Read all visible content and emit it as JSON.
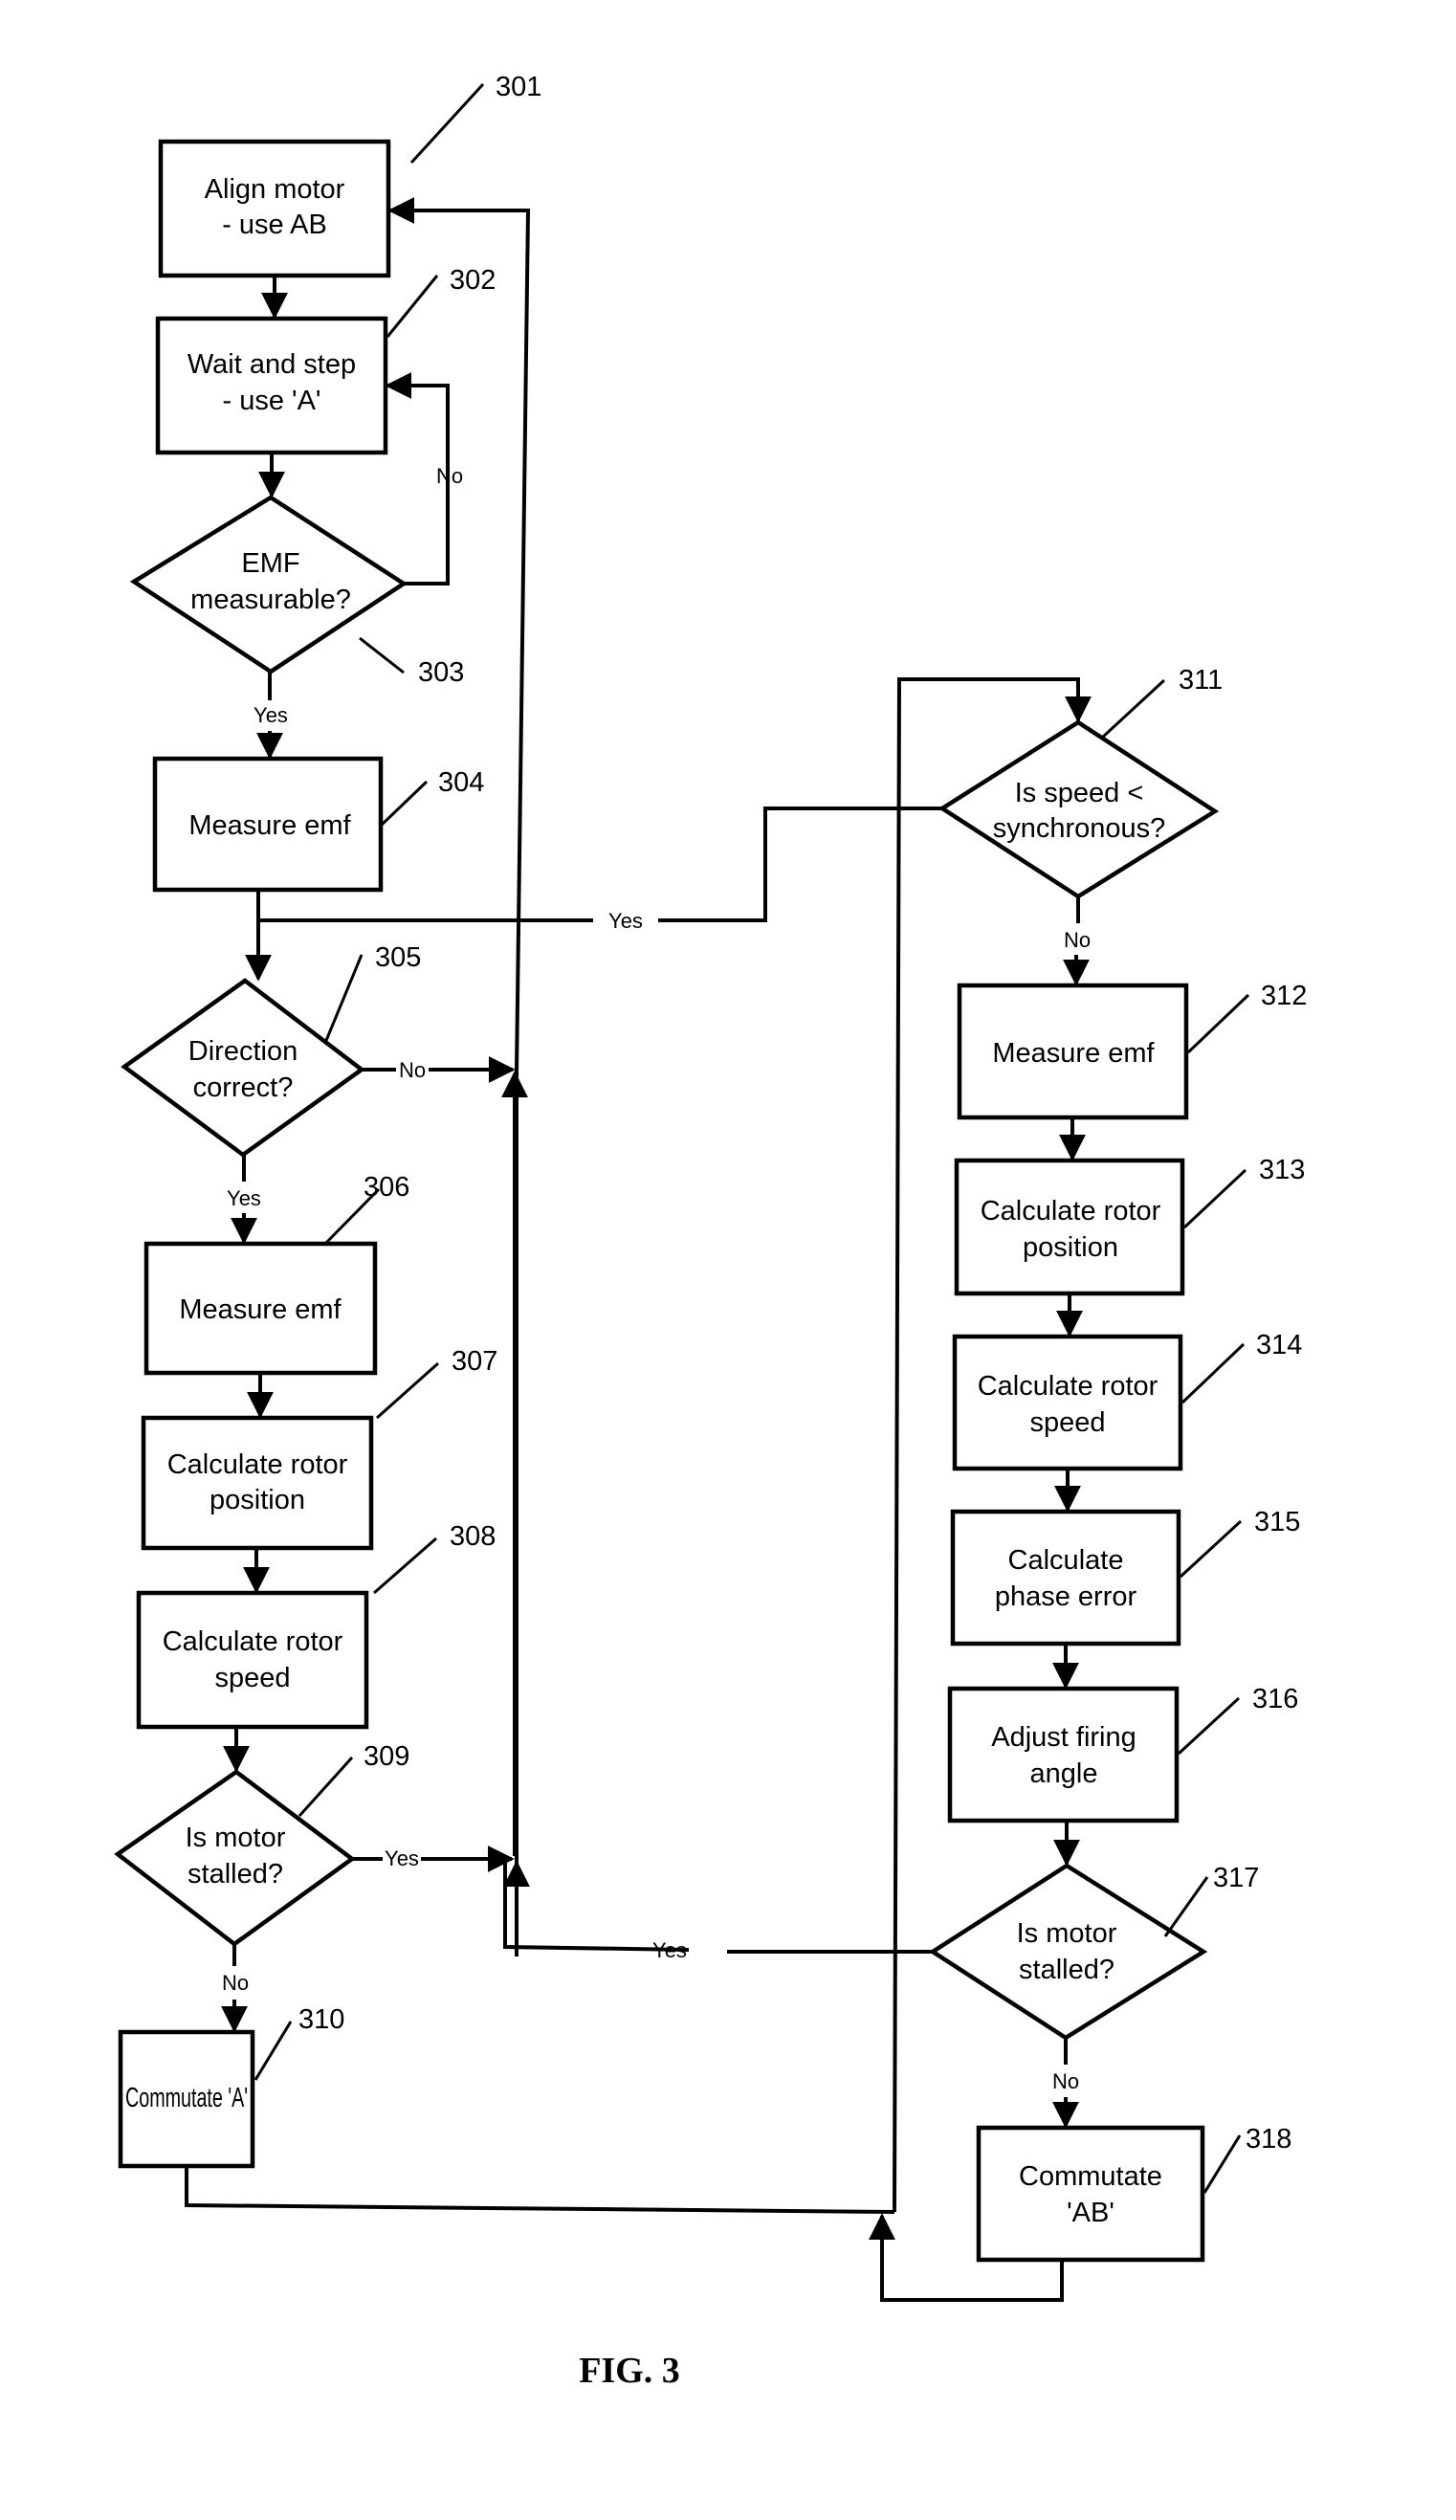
{
  "figure": {
    "caption": "FIG. 3",
    "nodes": [
      {
        "id": "301",
        "type": "process",
        "lines": [
          "Align motor",
          "- use AB"
        ]
      },
      {
        "id": "302",
        "type": "process",
        "lines": [
          "Wait and step",
          "- use 'A'"
        ]
      },
      {
        "id": "303",
        "type": "decision",
        "lines": [
          "EMF",
          "measurable?"
        ]
      },
      {
        "id": "304",
        "type": "process",
        "lines": [
          "Measure emf"
        ]
      },
      {
        "id": "305",
        "type": "decision",
        "lines": [
          "Direction",
          "correct?"
        ]
      },
      {
        "id": "306",
        "type": "process",
        "lines": [
          "Measure emf"
        ]
      },
      {
        "id": "307",
        "type": "process",
        "lines": [
          "Calculate rotor",
          "position"
        ]
      },
      {
        "id": "308",
        "type": "process",
        "lines": [
          "Calculate rotor",
          "speed"
        ]
      },
      {
        "id": "309",
        "type": "decision",
        "lines": [
          "Is motor",
          "stalled?"
        ]
      },
      {
        "id": "310",
        "type": "process",
        "lines": [
          "Commutate 'A'"
        ]
      },
      {
        "id": "311",
        "type": "decision",
        "lines": [
          "Is speed <",
          "synchronous?"
        ]
      },
      {
        "id": "312",
        "type": "process",
        "lines": [
          "Measure emf"
        ]
      },
      {
        "id": "313",
        "type": "process",
        "lines": [
          "Calculate rotor",
          "position"
        ]
      },
      {
        "id": "314",
        "type": "process",
        "lines": [
          "Calculate rotor",
          "speed"
        ]
      },
      {
        "id": "315",
        "type": "process",
        "lines": [
          "Calculate",
          "phase error"
        ]
      },
      {
        "id": "316",
        "type": "process",
        "lines": [
          "Adjust firing",
          "angle"
        ]
      },
      {
        "id": "317",
        "type": "decision",
        "lines": [
          "Is motor",
          "stalled?"
        ]
      },
      {
        "id": "318",
        "type": "process",
        "lines": [
          "Commutate",
          "'AB'"
        ]
      }
    ],
    "edges": [
      {
        "from": "301",
        "to": "302",
        "label": ""
      },
      {
        "from": "302",
        "to": "303",
        "label": ""
      },
      {
        "from": "303",
        "to": "302",
        "label": "No"
      },
      {
        "from": "303",
        "to": "304",
        "label": "Yes"
      },
      {
        "from": "304",
        "to": "305",
        "label": ""
      },
      {
        "from": "304",
        "to": "311",
        "label": "Yes"
      },
      {
        "from": "305",
        "to": "301",
        "label": "No"
      },
      {
        "from": "305",
        "to": "306",
        "label": "Yes"
      },
      {
        "from": "306",
        "to": "307",
        "label": ""
      },
      {
        "from": "307",
        "to": "308",
        "label": ""
      },
      {
        "from": "308",
        "to": "309",
        "label": ""
      },
      {
        "from": "309",
        "to": "301",
        "label": "Yes"
      },
      {
        "from": "309",
        "to": "310",
        "label": "No"
      },
      {
        "from": "310",
        "to": "311",
        "label": ""
      },
      {
        "from": "311",
        "to": "312",
        "label": "No"
      },
      {
        "from": "312",
        "to": "313",
        "label": ""
      },
      {
        "from": "313",
        "to": "314",
        "label": ""
      },
      {
        "from": "314",
        "to": "315",
        "label": ""
      },
      {
        "from": "315",
        "to": "316",
        "label": ""
      },
      {
        "from": "316",
        "to": "317",
        "label": ""
      },
      {
        "from": "317",
        "to": "301",
        "label": "Yes"
      },
      {
        "from": "317",
        "to": "318",
        "label": "No"
      },
      {
        "from": "318",
        "to": "311",
        "label": ""
      }
    ],
    "edge_labels": {
      "no_303": "No",
      "yes_303": "Yes",
      "yes_304_311": "Yes",
      "no_305": "No",
      "yes_305": "Yes",
      "yes_309": "Yes",
      "no_309": "No",
      "no_311": "No",
      "yes_317": "Yes",
      "no_317": "No"
    }
  }
}
